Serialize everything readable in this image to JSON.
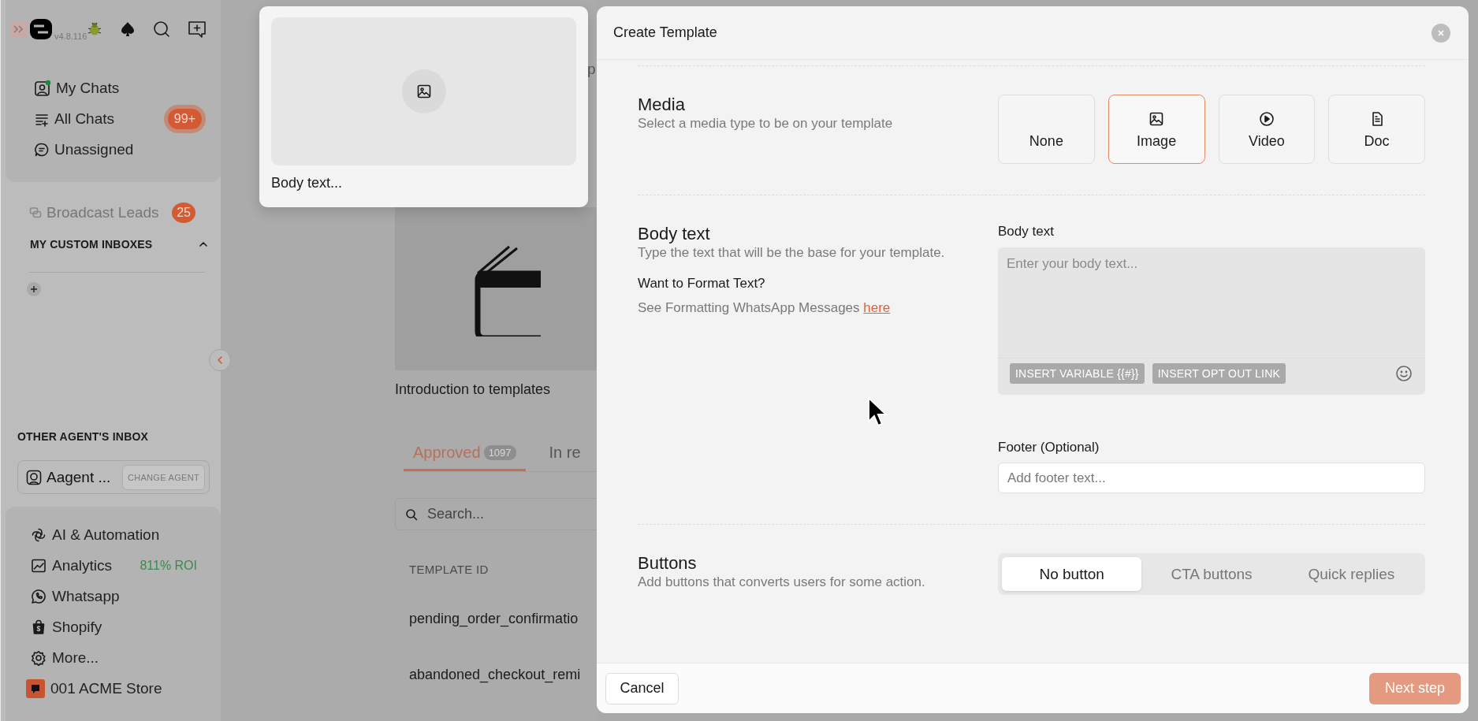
{
  "sidebar": {
    "version": "v4.8.116",
    "main_nav": [
      {
        "label": "My Chats"
      },
      {
        "label": "All Chats",
        "badge": "99+"
      },
      {
        "label": "Unassigned"
      }
    ],
    "inboxes": [
      {
        "label": "Broadcast Leads",
        "badge": "25"
      }
    ],
    "custom_inboxes": {
      "title": "MY CUSTOM INBOXES",
      "expanded": true
    },
    "other_agent": {
      "title": "OTHER AGENT'S INBOX",
      "agent": "Aagent ...",
      "button": "CHANGE AGENT"
    },
    "bottom_nav": [
      {
        "label": "AI & Automation"
      },
      {
        "label": "Analytics",
        "note": "811% ROI"
      },
      {
        "label": "Whatsapp"
      },
      {
        "label": "Shopify"
      },
      {
        "label": "More..."
      }
    ],
    "store": {
      "label": "001 ACME Store"
    }
  },
  "background": {
    "header_fragment": "p",
    "video_caption": "Introduction to templates",
    "tabs": [
      {
        "label": "Approved",
        "count": "1097",
        "selected": true
      },
      {
        "label": "In re",
        "selected": false
      }
    ],
    "search": {
      "placeholder": "Search..."
    },
    "table": {
      "columns": [
        "TEMPLATE ID"
      ],
      "rows": [
        [
          "pending_order_confirmatio"
        ],
        [
          "abandoned_checkout_remi"
        ]
      ]
    }
  },
  "preview": {
    "body": "Body text..."
  },
  "modal": {
    "title": "Create Template",
    "media": {
      "title": "Media",
      "subtitle": "Select a media type to be on your template",
      "options": [
        {
          "label": "None",
          "selected": false
        },
        {
          "label": "Image",
          "selected": true
        },
        {
          "label": "Video",
          "selected": false
        },
        {
          "label": "Doc",
          "selected": false
        }
      ]
    },
    "body": {
      "title": "Body text",
      "subtitle": "Type the text that will be the base for your template.",
      "format_title": "Want to Format Text?",
      "format_text": "See Formatting WhatsApp Messages",
      "format_link": "here",
      "field_label": "Body text",
      "placeholder": "Enter your body text...",
      "chips": [
        "INSERT VARIABLE {{#}}",
        "INSERT OPT OUT LINK"
      ]
    },
    "footer": {
      "label": "Footer (Optional)",
      "placeholder": "Add footer text..."
    },
    "buttons": {
      "title": "Buttons",
      "subtitle": "Add buttons that converts users for some action.",
      "options": [
        {
          "label": "No button",
          "selected": true
        },
        {
          "label": "CTA buttons",
          "selected": false
        },
        {
          "label": "Quick replies",
          "selected": false
        }
      ]
    },
    "actions": {
      "cancel": "Cancel",
      "next": {
        "label": "Next step",
        "disabled": true
      }
    }
  }
}
